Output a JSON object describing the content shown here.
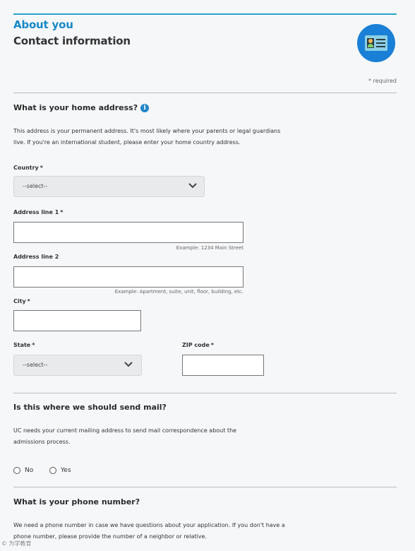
{
  "header": {
    "section_title": "About you",
    "page_title": "Contact information",
    "required_note": "* required"
  },
  "home_address": {
    "question": "What is your home address?",
    "description_line1": "This address is your permanent address. It's most likely where your parents or legal guardians",
    "description_line2": "live. If you're an international student, please enter your home country address.",
    "country_label": "Country",
    "country_value": "--select--",
    "address1_label": "Address line 1",
    "address1_value": "",
    "address1_hint": "Example: 1234 Main Street",
    "address2_label": "Address line 2",
    "address2_value": "",
    "address2_hint": "Example: Apartment, suite, unit, floor, building, etc.",
    "city_label": "City",
    "city_value": "",
    "state_label": "State",
    "state_value": "--select--",
    "zip_label": "ZIP code",
    "zip_value": "",
    "required_marker": "*"
  },
  "mailing": {
    "question": "Is this where we should send mail?",
    "description_line1": "UC needs your current mailing address to send mail correspondence about the",
    "description_line2": "admissions process.",
    "option_no": "No",
    "option_yes": "Yes"
  },
  "phone": {
    "question": "What is your phone number?",
    "description_line1": "We need a phone number in case we have questions about your application. If you don't have a",
    "description_line2": "phone number, please provide the number of a neighbor or relative."
  },
  "colors": {
    "accent": "#1789c7",
    "badge": "#1a7fd6",
    "info_icon": "#2186c8"
  },
  "icons": [
    "id-card-icon",
    "info-icon",
    "chevron-down-icon",
    "radio-icon"
  ],
  "watermark": "© 为学教育"
}
